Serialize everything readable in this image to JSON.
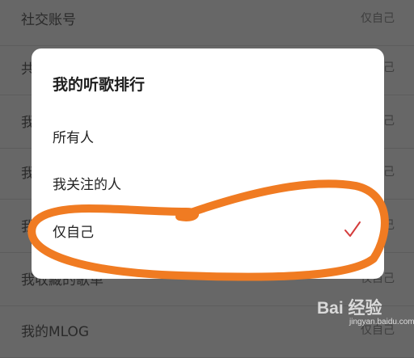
{
  "background_list": {
    "items": [
      {
        "label": "社交账号",
        "value": "仅自己"
      },
      {
        "label": "共",
        "value": "己"
      },
      {
        "label": "我",
        "value": "己"
      },
      {
        "label": "我",
        "value": "己"
      },
      {
        "label": "我",
        "value": "己"
      },
      {
        "label": "我收藏的歌单",
        "value": "仅自己"
      },
      {
        "label": "我的MLOG",
        "value": "仅自己"
      }
    ]
  },
  "dialog": {
    "title": "我的听歌排行",
    "options": [
      {
        "label": "所有人",
        "selected": false
      },
      {
        "label": "我关注的人",
        "selected": false
      },
      {
        "label": "仅自己",
        "selected": true
      }
    ]
  },
  "icons": {
    "selected_check": "check-icon"
  },
  "colors": {
    "overlay_bg": "#676767",
    "dialog_bg": "#ffffff",
    "check": "#d43c3c",
    "annotation": "#f07b22"
  },
  "watermark": {
    "main": "Bai 经验",
    "sub": "jingyan.baidu.com"
  }
}
